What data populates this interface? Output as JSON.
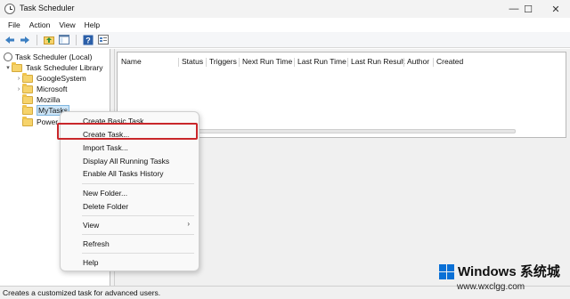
{
  "window": {
    "title": "Task Scheduler",
    "controls": {
      "minimize": "—",
      "maximize": "☐",
      "close": "✕"
    }
  },
  "menubar": {
    "items": [
      "File",
      "Action",
      "View",
      "Help"
    ]
  },
  "toolbar": {
    "icons": [
      "back-arrow-icon",
      "forward-arrow-icon",
      "folder-up-icon",
      "show-hide-console-tree-icon",
      "help-icon",
      "properties-icon"
    ]
  },
  "tree": {
    "root": "Task Scheduler (Local)",
    "library": "Task Scheduler Library",
    "children": [
      "GoogleSystem",
      "Microsoft",
      "Mozilla",
      "MyTasks",
      "Power"
    ]
  },
  "task_list": {
    "columns": [
      "Name",
      "Status",
      "Triggers",
      "Next Run Time",
      "Last Run Time",
      "Last Run Result",
      "Author",
      "Created"
    ]
  },
  "context_menu": {
    "items": [
      "Create Basic Task...",
      "Create Task...",
      "Import Task...",
      "Display All Running Tasks",
      "Enable All Tasks History",
      "New Folder...",
      "Delete Folder",
      "View",
      "Refresh",
      "Help"
    ],
    "view_submenu_arrow": "›",
    "highlighted_item": "Create Task..."
  },
  "status_bar": {
    "text": "Creates a customized task for advanced users."
  },
  "watermark": {
    "title": "Windows 系统城",
    "url": "www.wxclgg.com"
  },
  "colors": {
    "accent": "#0a70d6",
    "highlight_border": "#c9262a",
    "selection_bg": "#cde5f7",
    "folder": "#f6d36b"
  }
}
